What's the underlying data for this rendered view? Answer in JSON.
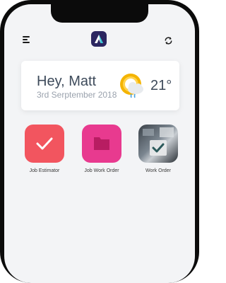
{
  "header": {
    "menu_icon": "hamburger-icon",
    "logo_icon": "app-logo-icon",
    "sync_icon": "sync-icon"
  },
  "welcome_card": {
    "greeting": "Hey, Matt",
    "date": "3rd Serptember 2018",
    "weather_icon": "sun-cloud-rain-icon",
    "temperature": "21°"
  },
  "apps": [
    {
      "label": "Job Estimator",
      "icon": "checkmark-icon",
      "color": "#f2555f"
    },
    {
      "label": "Job Work Order",
      "icon": "folder-icon",
      "color": "#e83a8f"
    },
    {
      "label": "Work Order",
      "icon": "photo-checkbox-icon",
      "color": "#5c666f"
    }
  ],
  "colors": {
    "logo_bg": "#2b2660",
    "logo_accent": "#36c7d6",
    "sun": "#f4b400"
  }
}
